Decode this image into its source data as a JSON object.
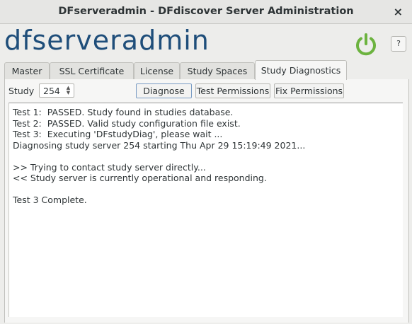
{
  "window": {
    "title": "DFserveradmin - DFdiscover Server Administration",
    "close_glyph": "×"
  },
  "header": {
    "logo_text": "dfserveradmin",
    "power_icon": "power-icon",
    "power_color": "#6cb33f",
    "help_label": "?"
  },
  "tabs": [
    {
      "label": "Master"
    },
    {
      "label": "SSL Certificate"
    },
    {
      "label": "License"
    },
    {
      "label": "Study Spaces"
    },
    {
      "label": "Study Diagnostics",
      "active": true
    }
  ],
  "toolbar": {
    "study_label": "Study",
    "study_value": "254",
    "diagnose_label": "Diagnose",
    "test_permissions_label": "Test Permissions",
    "fix_permissions_label": "Fix Permissions"
  },
  "output": {
    "lines": [
      "Test 1:  PASSED. Study found in studies database.",
      "Test 2:  PASSED. Valid study configuration file exist.",
      "Test 3:  Executing 'DFstudyDiag', please wait ...",
      "Diagnosing study server 254 starting Thu Apr 29 15:19:49 2021...",
      "",
      ">> Trying to contact study server directly...",
      "<< Study server is currently operational and responding.",
      "",
      "Test 3 Complete."
    ]
  }
}
